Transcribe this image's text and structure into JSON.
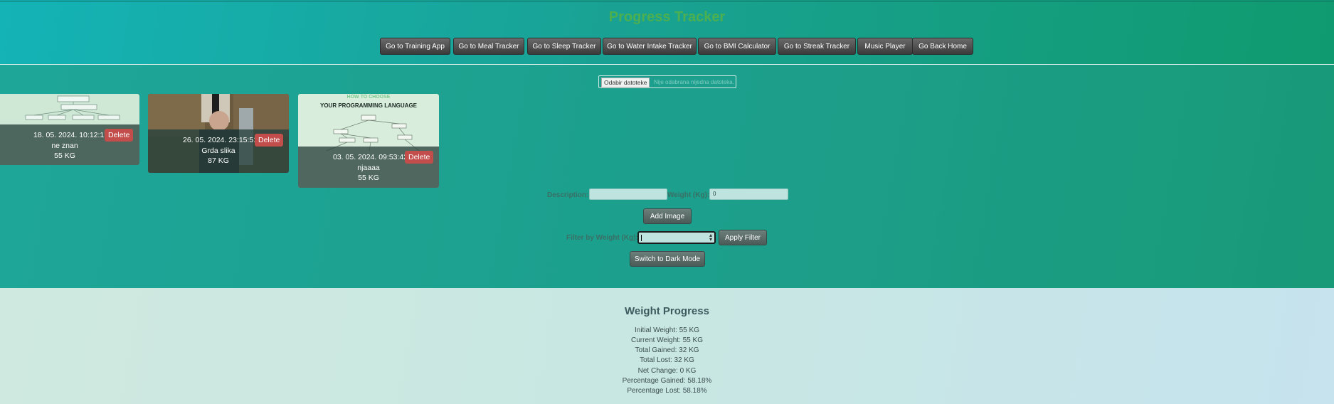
{
  "app": {
    "title": "Progress Tracker"
  },
  "nav": [
    {
      "label": "Go to Training App"
    },
    {
      "label": "Go to Meal Tracker"
    },
    {
      "label": "Go to Sleep Tracker"
    },
    {
      "label": "Go to Water Intake Tracker"
    },
    {
      "label": "Go to BMI Calculator"
    },
    {
      "label": "Go to Streak Tracker"
    },
    {
      "label": "Music Player"
    },
    {
      "label": "Go Back Home"
    }
  ],
  "file_input": {
    "button_label": "Odabir datoteke",
    "status_text": "Nije odabrana nijedna datoteka."
  },
  "cards": [
    {
      "date": "18. 05. 2024. 10:12:17",
      "delete_label": "Delete",
      "description": "ne znan",
      "weight": "55 KG"
    },
    {
      "date": "26. 05. 2024. 23:15:51",
      "delete_label": "Delete",
      "description": "Grda slika",
      "weight": "87 KG"
    },
    {
      "date": "03. 05. 2024. 09:53:42",
      "delete_label": "Delete",
      "description": "njaaaa",
      "weight": "55 KG",
      "thumb_heading_1": "HOW TO CHOOSE",
      "thumb_heading_2": "YOUR PROGRAMMING LANGUAGE"
    }
  ],
  "form": {
    "description_label": "Description:",
    "weight_label": "Weight (Kg):",
    "weight_value": "0",
    "add_image_label": "Add Image",
    "filter_label": "Filter by Weight (Kg):",
    "apply_filter_label": "Apply Filter",
    "dark_mode_label": "Switch to Dark Mode"
  },
  "progress": {
    "title": "Weight Progress",
    "stats": [
      "Initial Weight: 55 KG",
      "Current Weight: 55 KG",
      "Total Gained: 32 KG",
      "Total Lost: 32 KG",
      "Net Change: 0 KG",
      "Percentage Gained: 58.18%",
      "Percentage Lost: 58.18%"
    ]
  }
}
